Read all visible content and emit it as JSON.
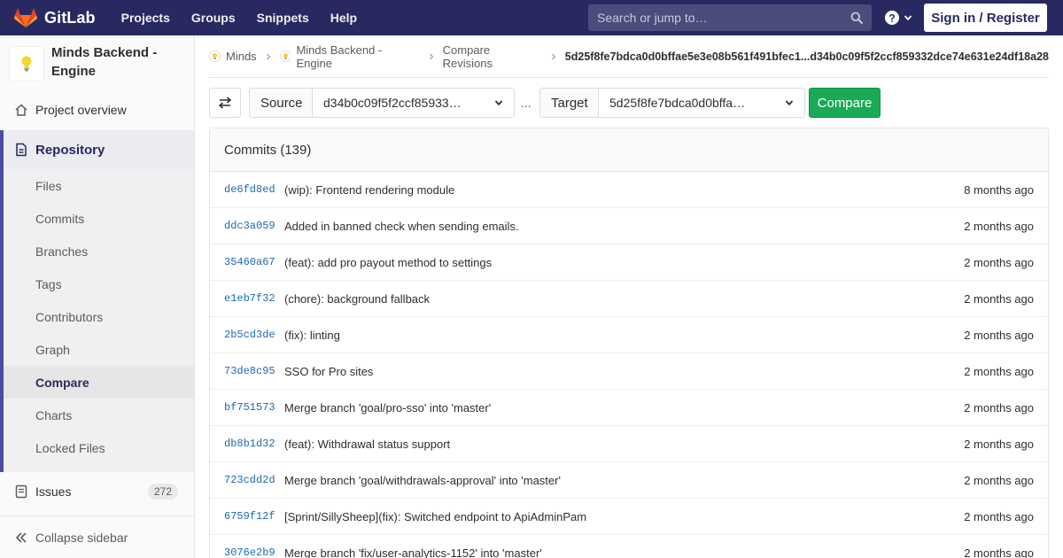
{
  "navbar": {
    "brand": "GitLab",
    "links": [
      "Projects",
      "Groups",
      "Snippets",
      "Help"
    ],
    "search_placeholder": "Search or jump to…",
    "signin": "Sign in / Register"
  },
  "sidebar": {
    "project_name": "Minds Backend - Engine",
    "project_overview": "Project overview",
    "repository": "Repository",
    "repo_items": [
      "Files",
      "Commits",
      "Branches",
      "Tags",
      "Contributors",
      "Graph",
      "Compare",
      "Charts",
      "Locked Files"
    ],
    "active_item": "Compare",
    "issues": "Issues",
    "issues_count": "272",
    "collapse": "Collapse sidebar"
  },
  "breadcrumb": {
    "items": [
      "Minds",
      "Minds Backend - Engine",
      "Compare Revisions"
    ],
    "current": "5d25f8fe7bdca0d0bffae5e3e08b561f491bfec1...d34b0c09f5f2ccf859332dce74e631e24df18a28"
  },
  "compare": {
    "source_label": "Source",
    "source_value": "d34b0c09f5f2ccf85933…",
    "separator": "...",
    "target_label": "Target",
    "target_value": "5d25f8fe7bdca0d0bffa…",
    "button": "Compare"
  },
  "commits": {
    "header": "Commits (139)",
    "rows": [
      {
        "sha": "de6fd8ed",
        "message": "(wip): Frontend rendering module",
        "time": "8 months ago"
      },
      {
        "sha": "ddc3a059",
        "message": "Added in banned check when sending emails.",
        "time": "2 months ago"
      },
      {
        "sha": "35460a67",
        "message": "(feat): add pro payout method to settings",
        "time": "2 months ago"
      },
      {
        "sha": "e1eb7f32",
        "message": "(chore): background fallback",
        "time": "2 months ago"
      },
      {
        "sha": "2b5cd3de",
        "message": "(fix): linting",
        "time": "2 months ago"
      },
      {
        "sha": "73de8c95",
        "message": "SSO for Pro sites",
        "time": "2 months ago"
      },
      {
        "sha": "bf751573",
        "message": "Merge branch 'goal/pro-sso' into 'master'",
        "time": "2 months ago"
      },
      {
        "sha": "db8b1d32",
        "message": "(feat): Withdrawal status support",
        "time": "2 months ago"
      },
      {
        "sha": "723cdd2d",
        "message": "Merge branch 'goal/withdrawals-approval' into 'master'",
        "time": "2 months ago"
      },
      {
        "sha": "6759f12f",
        "message": "[Sprint/SillySheep](fix): Switched endpoint to ApiAdminPam",
        "time": "2 months ago"
      },
      {
        "sha": "3076e2b9",
        "message": "Merge branch 'fix/user-analytics-1152' into 'master'",
        "time": "2 months ago"
      }
    ]
  },
  "colors": {
    "navbar": "#292961",
    "accent": "#4b4ba3",
    "compare_button": "#1aaa55",
    "sha_link": "#1b69b6"
  },
  "icons": {
    "brand": "gitlab-tanuki-icon",
    "search": "search-icon",
    "help": "question-circle-icon",
    "project_avatar": "lightbulb-icon",
    "overview": "home-icon",
    "repository": "doc-text-icon",
    "issues": "issues-icon",
    "collapse": "double-chevron-left-icon",
    "swap": "swap-arrows-icon"
  }
}
